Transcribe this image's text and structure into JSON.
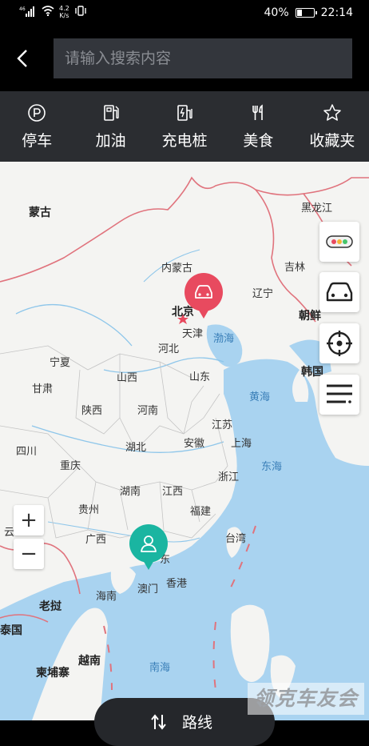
{
  "status_bar": {
    "signal": "46",
    "net_speed_value": "4.2",
    "net_speed_unit": "K/s",
    "battery_percent": "40%",
    "battery_level": 0.4,
    "time": "22:14"
  },
  "search": {
    "placeholder": "请输入搜索内容"
  },
  "categories": [
    {
      "label": "停车",
      "icon": "parking-icon"
    },
    {
      "label": "加油",
      "icon": "fuel-icon"
    },
    {
      "label": "充电桩",
      "icon": "charging-pile-icon"
    },
    {
      "label": "美食",
      "icon": "food-icon"
    },
    {
      "label": "收藏夹",
      "icon": "star-icon"
    }
  ],
  "map": {
    "labels": {
      "mongolia": "蒙古",
      "heilongjiang": "黑龙江",
      "inner_mongolia": "内蒙古",
      "jilin": "吉林",
      "liaoning": "辽宁",
      "north_korea": "朝鲜",
      "beijing": "北京",
      "tianjin": "天津",
      "bohai": "渤海",
      "hebei": "河北",
      "south_korea": "韩国",
      "ningxia": "宁夏",
      "shanxi": "山西",
      "shandong": "山东",
      "gansu": "甘肃",
      "yellow_sea": "黄海",
      "shaanxi": "陕西",
      "henan": "河南",
      "jiangsu": "江苏",
      "sichuan": "四川",
      "hubei": "湖北",
      "anhui": "安徽",
      "shanghai": "上海",
      "chongqing": "重庆",
      "east_sea": "东海",
      "zhejiang": "浙江",
      "hunan": "湖南",
      "jiangxi": "江西",
      "guizhou": "贵州",
      "fujian": "福建",
      "yunnan": "云",
      "guangxi": "广西",
      "guangdong": "东",
      "taiwan": "台湾",
      "macau": "澳门",
      "hongkong": "香港",
      "hainan": "海南",
      "laos": "老挝",
      "thailand": "泰国",
      "vietnam": "越南",
      "cambodia": "柬埔寨",
      "south_sea": "南海"
    },
    "controls": {
      "zoom_in": "+",
      "zoom_out": "−"
    }
  },
  "route_button": {
    "label": "路线"
  },
  "watermark": "领克车友会",
  "colors": {
    "topbar": "#000000",
    "category_bar": "#2b2d31",
    "car_pin": "#e84a5f",
    "user_pin": "#1ab5a1",
    "sea": "#a9d3f0",
    "border": "#e0737d"
  }
}
